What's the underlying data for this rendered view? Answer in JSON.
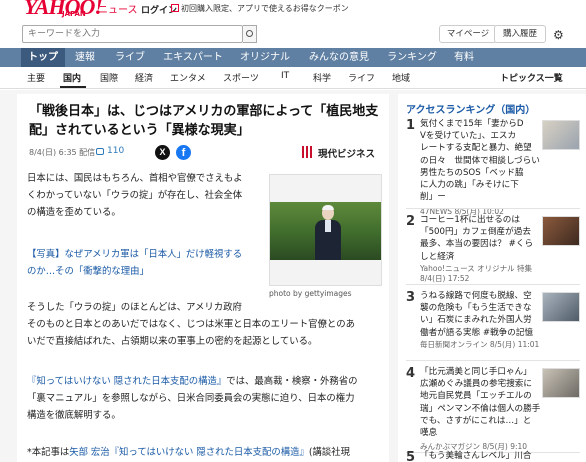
{
  "header": {
    "logo": "YAHOO!",
    "logo_sub": "JAPAN",
    "service": "ニュース",
    "login": "ログイン",
    "promo": "初回購入限定、アプリで使えるお得なクーポン"
  },
  "search": {
    "placeholder": "キーワードを入力",
    "buttons": [
      "マイページ",
      "購入履歴"
    ]
  },
  "nav_main": [
    "トップ",
    "速報",
    "ライブ",
    "エキスパート",
    "オリジナル",
    "みんなの意見",
    "ランキング",
    "有料"
  ],
  "nav_sub": {
    "items": [
      "主要",
      "国内",
      "国際",
      "経済",
      "エンタメ",
      "スポーツ",
      "IT",
      "科学",
      "ライフ",
      "地域"
    ],
    "topics": "トピックス一覧"
  },
  "article": {
    "title_lines": [
      "「戦後日本」は、じつはアメリカの軍部によって「植民地支",
      "配」されているという「異様な現実」"
    ],
    "date": "8/4(日) 6:35 配信",
    "comments": "110",
    "publisher": "現代ビジネス",
    "p1": [
      "日本には、国民はもちろん、首相や官僚でさえもよ",
      "くわかっていない「ウラの掟」が存在し、社会全体",
      "の構造を歪めている。"
    ],
    "link1": [
      "【写真】なぜアメリカ軍は「日本人」だけ軽視する",
      "のか…その「衝撃的な理由」"
    ],
    "p2": [
      "そうした「ウラの掟」のほとんどは、アメリカ政府",
      "そのものと日本とのあいだではなく、じつは米軍と日本のエリート官僚とのあ",
      "いだで直接結ばれた、占領期以来の軍事上の密約を起源としている。"
    ],
    "p3_link": "『知ってはいけない 隠された日本支配の構造』",
    "p3_rest": "では、最高裁・検察・外務省の",
    "p3_lines": [
      "「裏マニュアル」を参照しながら、日米合同委員会の実態に迫り、日本の権力",
      "構造を徹底解明する。"
    ],
    "footnote_prefix": "*本記事は",
    "footnote_link": "矢部 宏治『知ってはいけない 隠された日本支配の構造』",
    "footnote_rest": "(講談社現",
    "photo_caption": "photo by gettyimages"
  },
  "sidebar": {
    "title": "アクセスランキング（国内）",
    "items": [
      {
        "rank": "1",
        "lines": [
          "気付くまで15年「妻からD",
          "Vを受けていた」、エスカ",
          "レートする支配と暴力、絶望",
          "の日々　世間体で相談しづらい",
          "男性たちのSOS「ベッド脇",
          "に人力の跳」「みそけに下",
          "削」ー"
        ],
        "meta": "47NEWS 8/5(月) 10:02"
      },
      {
        "rank": "2",
        "lines": [
          "コーヒー1杯に出せるのは",
          "「500円」カフェ倒産が過去",
          "最多、本当の要因は？ #くら",
          "しと経済"
        ],
        "meta": "Yahoo!ニュース オリジナル 特集 8/4(日) 17:52"
      },
      {
        "rank": "3",
        "lines": [
          "うねる線路で何度も脱線、空",
          "襲の危険も「もう生活できな",
          "い」石炭にまみれた外国人労",
          "働者が語る実態 #戦争の記憶"
        ],
        "meta": "毎日新聞オンライン 8/5(月) 11:01"
      },
      {
        "rank": "4",
        "lines": [
          "「比元満美と同じ手口ゃん」",
          "広瀬めぐみ議員の参宅捜索に",
          "地元自民党員「エッチエルの",
          "瑞」ペンマン不倫は個人の勝手",
          "でも、さすがにこれは…」と",
          "嘆息"
        ],
        "meta": "みんかぶマガジン 8/5(月) 9:10"
      },
      {
        "rank": "5",
        "lines": [
          "「もう美輪さんレベル」川合"
        ],
        "meta": ""
      }
    ]
  },
  "colors": {
    "brand": "#e60033",
    "nav_bg": "#6080a3",
    "nav_active": "#3c5a7d",
    "link": "#1a5aa6"
  },
  "icons": [
    "search-icon",
    "gift-icon",
    "gear-icon",
    "comment-icon",
    "x-share-icon",
    "facebook-share-icon",
    "publisher-logo-icon"
  ]
}
